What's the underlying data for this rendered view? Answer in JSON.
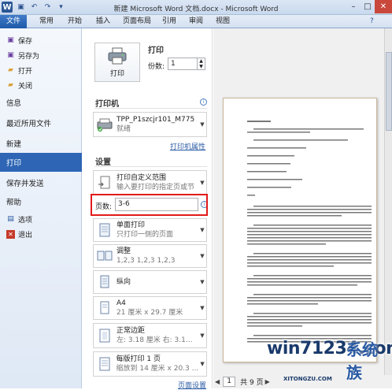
{
  "window": {
    "title": "新建 Microsoft Word 文档.docx - Microsoft Word",
    "controls": [
      "–",
      "□",
      "✕"
    ]
  },
  "ribbon": {
    "tabs": [
      "文件",
      "常用",
      "开始",
      "插入",
      "页面布局",
      "引用",
      "审阅",
      "视图"
    ]
  },
  "backstage": {
    "save": "保存",
    "save_as": "另存为",
    "open": "打开",
    "close": "关闭",
    "info": "信息",
    "recent": "最近所用文件",
    "new": "新建",
    "print": "打印",
    "save_send": "保存并发送",
    "help": "帮助",
    "options": "选项",
    "exit": "退出"
  },
  "print": {
    "heading": "打印",
    "button_label": "打印",
    "copies_label": "份数:",
    "copies_value": "1"
  },
  "printer": {
    "heading": "打印机",
    "name": "TPP_P1szcjr101_M775",
    "status": "就绪",
    "properties_link": "打印机属性"
  },
  "settings": {
    "heading": "设置",
    "range_main": "打印自定义范围",
    "range_sub": "输入要打印的指定页或节",
    "pages_label": "页数:",
    "pages_value": "3-6",
    "sides_main": "单面打印",
    "sides_sub": "只打印一侧的页面",
    "collate_main": "调整",
    "collate_sub": "1,2,3    1,2,3    1,2,3",
    "orientation_main": "纵向",
    "paper_main": "A4",
    "paper_sub": "21 厘米 x 29.7 厘米",
    "margins_main": "正常边距",
    "margins_sub": "左: 3.18 厘米    右: 3.1...",
    "pps_main": "每版打印 1 页",
    "pps_sub": "缩放到 14 厘米 x 20.3 ...",
    "page_setup_link": "页面设置"
  },
  "preview": {
    "current_page": "1",
    "total_pages": "共 9 页"
  },
  "watermark": {
    "main": "win71234.com",
    "side": "系统族",
    "small": "XITONGZU.COM"
  },
  "colors": {
    "file_tab": "#2e66b5",
    "highlight": "#e21a1a",
    "link": "#2a5aa3"
  }
}
